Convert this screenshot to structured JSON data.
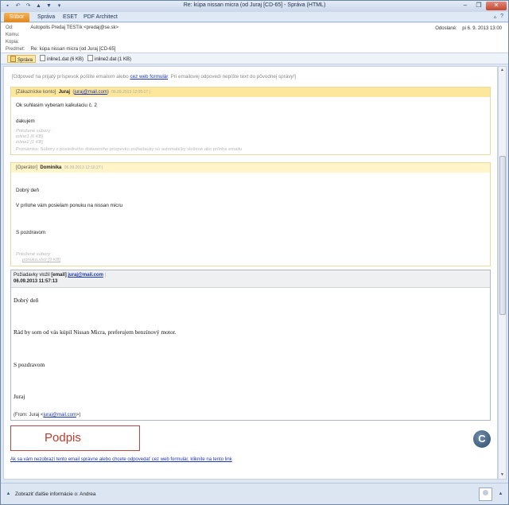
{
  "window": {
    "title": "Re: kúpa nissan micra (od Juraj [CD-65] - Správa (HTML)",
    "qat_icons": [
      "save-icon",
      "undo-icon",
      "redo-icon",
      "up-icon",
      "down-icon",
      "dropdown-icon"
    ],
    "controls": {
      "minimize": "–",
      "restore": "❐",
      "close": "✕"
    }
  },
  "ribbon": {
    "tabs": [
      "Súbor",
      "Správa",
      "ESET",
      "PDF Architect"
    ],
    "right_icons": {
      "minimize": "▵",
      "help": "?"
    }
  },
  "header": {
    "from_label": "Od:",
    "from_value": "Autopolis Predaj TESTík <predaj@se.sk>",
    "to_label": "Komu:",
    "to_value": "",
    "cc_label": "Kópia:",
    "cc_value": "",
    "subject_label": "Predmet:",
    "subject_value": "Re: kúpa nissan micra (od Juraj [CD-65]",
    "sent_label": "Odoslané:",
    "sent_value": "pi 6. 9. 2013 13:00"
  },
  "attachments": [
    {
      "name": "Správa",
      "selected": true
    },
    {
      "name": "inline1.dat (6 KB)",
      "selected": false
    },
    {
      "name": "inline2.dat (1 KB)",
      "selected": false
    }
  ],
  "body": {
    "notice_pre": "[Odpoveď na prijatý príspevok pošlite emailom alebo ",
    "notice_link": "cez web formulár",
    "notice_post": ". Pri emailovej odpovedi nepíšte text do pôvodnej správy!]",
    "block1": {
      "role": "[Zákaznícke konto]",
      "name": "Juraj",
      "email": "juraj@mail.com",
      "date": "06.09.2013 12:05:17 |",
      "line1": "Ok suhlasim vyberam kalkulaciu č. 2",
      "line2": "dakujem",
      "att_label": "Priložené súbory :",
      "att1": "inline1 [6 KB]",
      "att2": "inline2 [1 KB]",
      "note": "Poznámka: Súbory z posledného diskusného príspevku požiadavky sú automaticky vložené ako príloha emailu"
    },
    "block2": {
      "role": "[Operátor]",
      "name": "Dominika",
      "date": "06.09.2013 12:16:27 |",
      "line1": "Dobrý deň",
      "line2": "V prílohe vám posielam ponuku na nissan micru",
      "line3": "S pozdravom",
      "att_label": "Priložené súbory :",
      "att1": "ponuka.xlsx [9 KB]"
    },
    "block3": {
      "label": "Požiadavky vložil",
      "bold": "[email]",
      "email": "juraj@mail.com",
      "date": "06.09.2013 11:57:13",
      "line1": "Dobrý deň",
      "line2": "Rád by som od vás kúpil Nissan Micra, preferujem benzínový motor.",
      "line3": "S pozdravom",
      "line4": "Juraj",
      "from_pre": "(From: Juraj <",
      "from_email": "juraj@mail.com",
      "from_post": ">)"
    },
    "signature": "Podpis",
    "logo_letter": "C",
    "bottom_link": "Ak sa vám nezobrazí tento email správne alebo chcete odpovedať cez web formulár, kliknite na tento link"
  },
  "people_pane": {
    "text": "Zobraziť ďalšie informácie o: Andrea"
  }
}
